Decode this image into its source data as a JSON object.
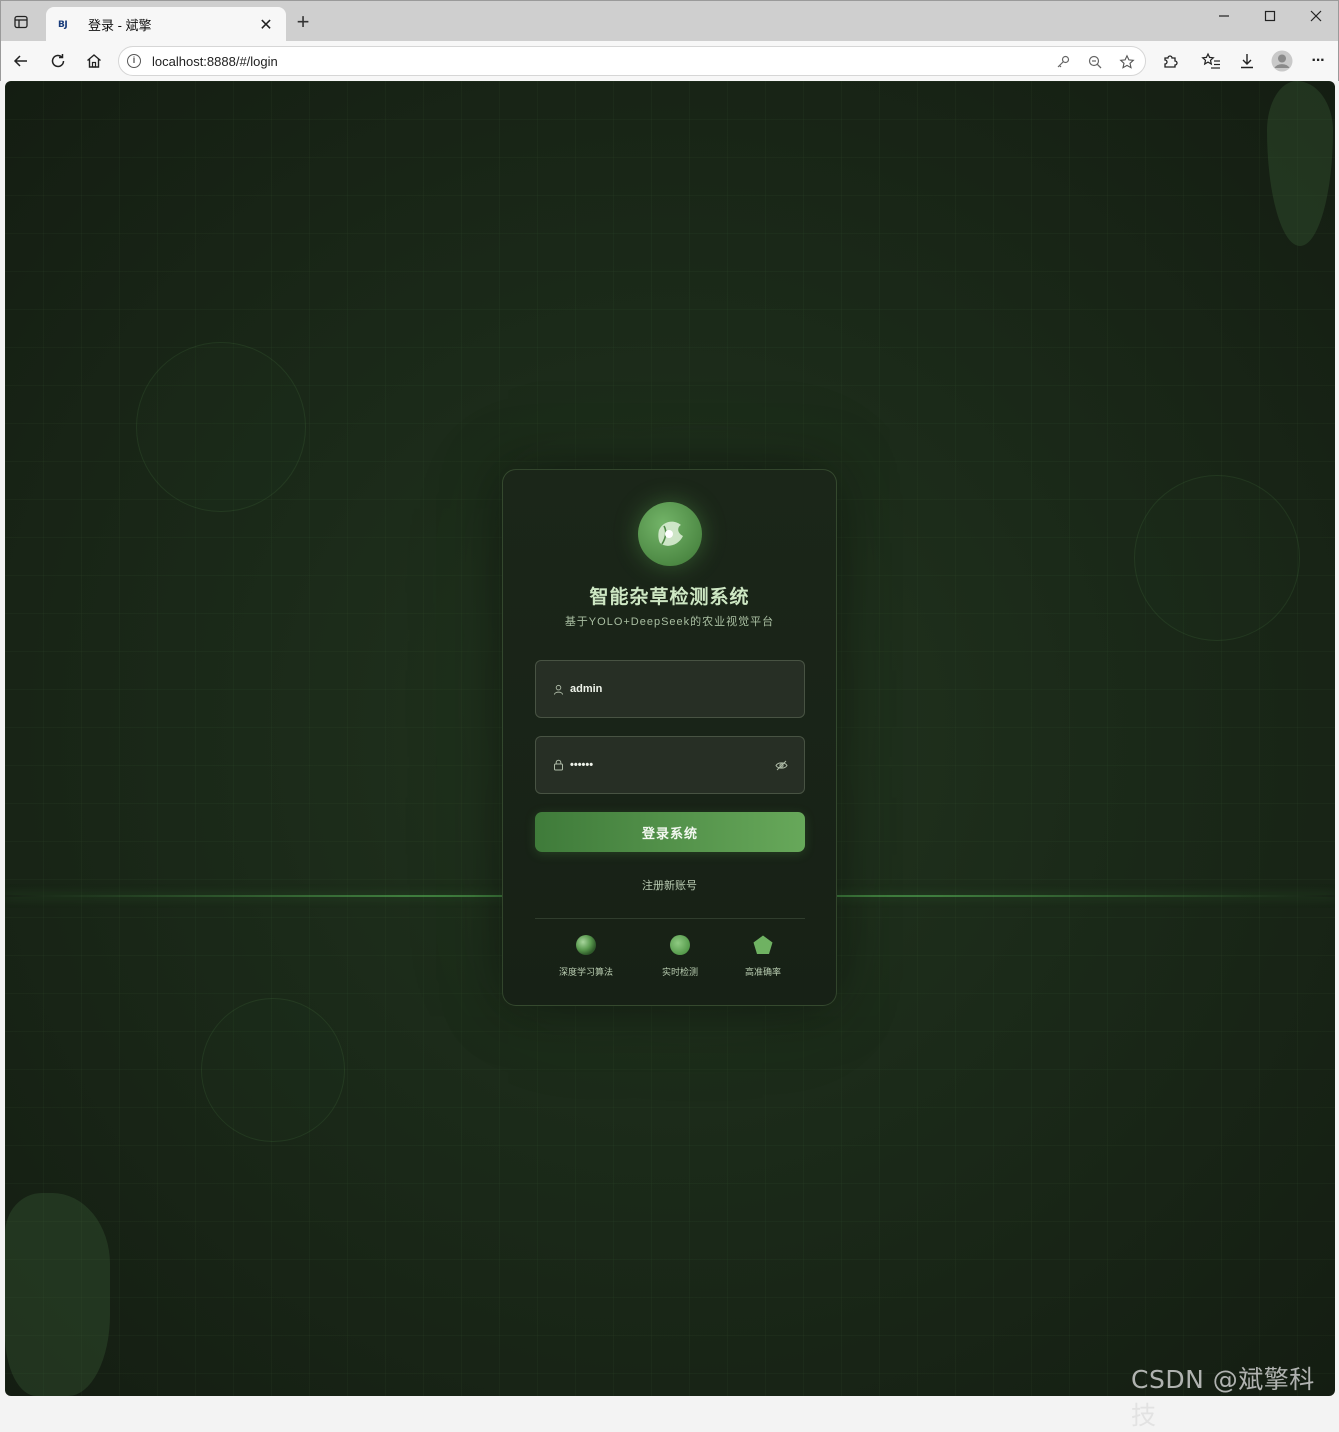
{
  "browser": {
    "tab": {
      "favicon_text": "BJ",
      "title": "登录 - 斌擎",
      "close": "✕"
    },
    "new_tab": "+",
    "window_controls": [
      "—",
      "☐",
      "✕"
    ],
    "address": {
      "url": "localhost:8888/#/login"
    },
    "more_menu": "···"
  },
  "login": {
    "title": "智能杂草检测系统",
    "subtitle": "基于YOLO+DeepSeek的农业视觉平台",
    "username_value": "admin",
    "password_value": "••••••",
    "login_button": "登录系统",
    "register_link": "注册新账号",
    "features": [
      {
        "label": "深度学习算法",
        "icon": "sphere-icon"
      },
      {
        "label": "实时检测",
        "icon": "circle-icon"
      },
      {
        "label": "高准确率",
        "icon": "pentagon-icon"
      }
    ]
  },
  "watermark": "CSDN @斌擎科技",
  "colors": {
    "accent": "#5f9e54",
    "background": "#1b2a19",
    "card": "#1a2518",
    "title": "#cde7c3"
  }
}
